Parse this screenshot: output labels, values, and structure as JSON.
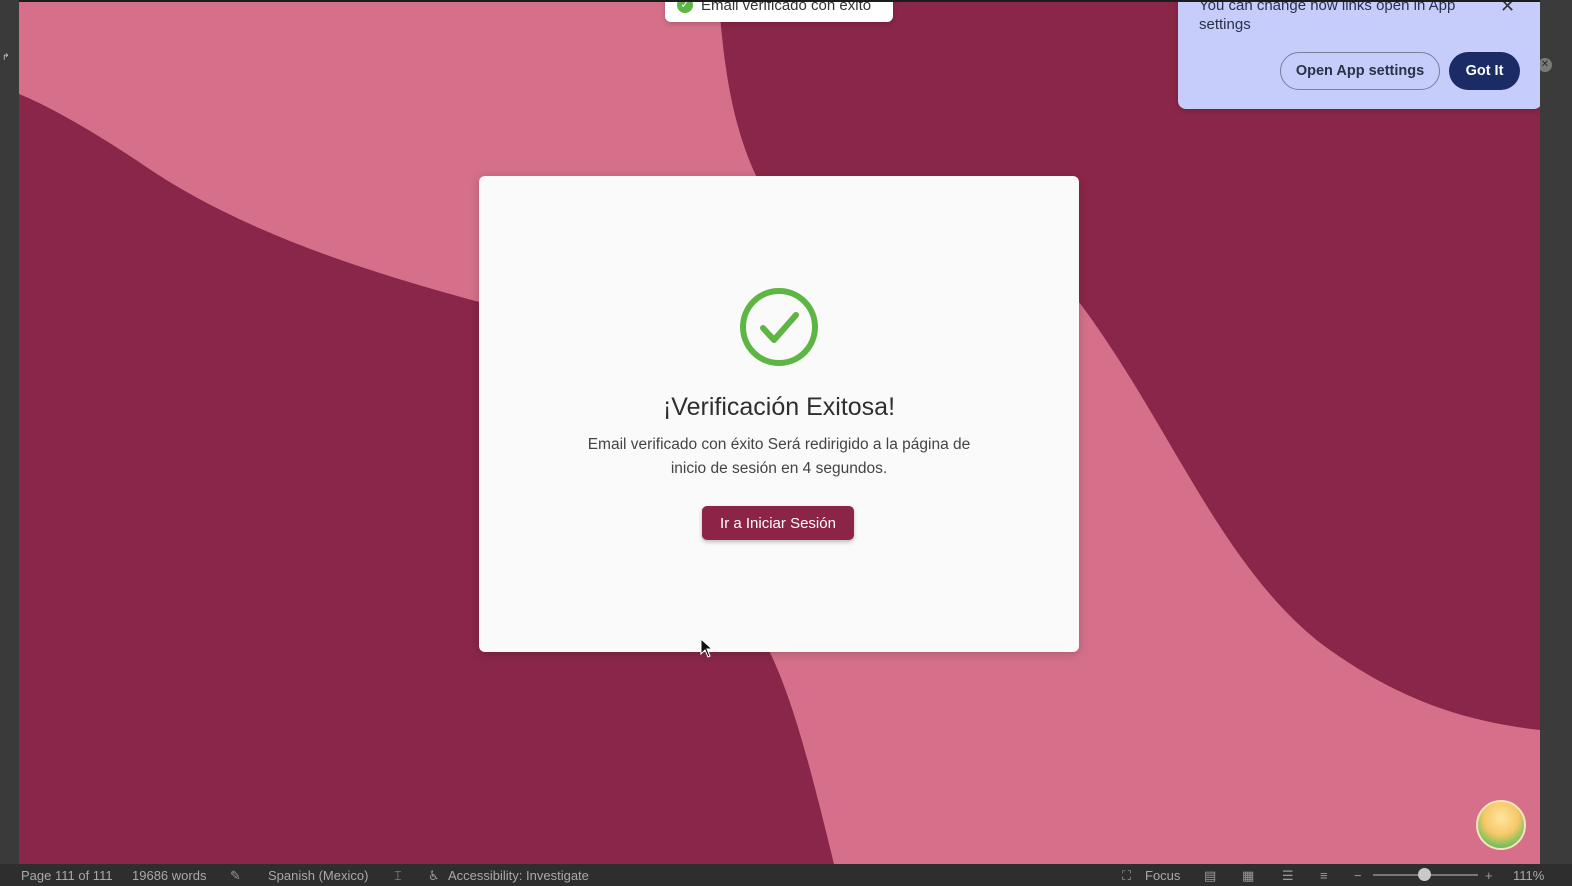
{
  "toast": {
    "text": "Email verificado con éxito",
    "icon": "check-circle-icon"
  },
  "card": {
    "icon": "check-circle-icon",
    "icon_color": "#5db544",
    "title": "¡Verificación Exitosa!",
    "message": "Email verificado con éxito Será redirigido a la página de inicio de sesión en 4 segundos.",
    "button_label": "Ir a Iniciar Sesión",
    "button_color": "#8b2447"
  },
  "popup": {
    "text": "You can change how links open in App settings",
    "open_settings_label": "Open App settings",
    "got_it_label": "Got It",
    "background": "#c6cdfb"
  },
  "background": {
    "dark": "#8a2649",
    "light": "#d6708a"
  },
  "statusbar": {
    "page": "Page 111 of 111",
    "words": "19686 words",
    "language": "Spanish (Mexico)",
    "accessibility": "Accessibility: Investigate",
    "focus": "Focus",
    "zoom": "111%"
  }
}
